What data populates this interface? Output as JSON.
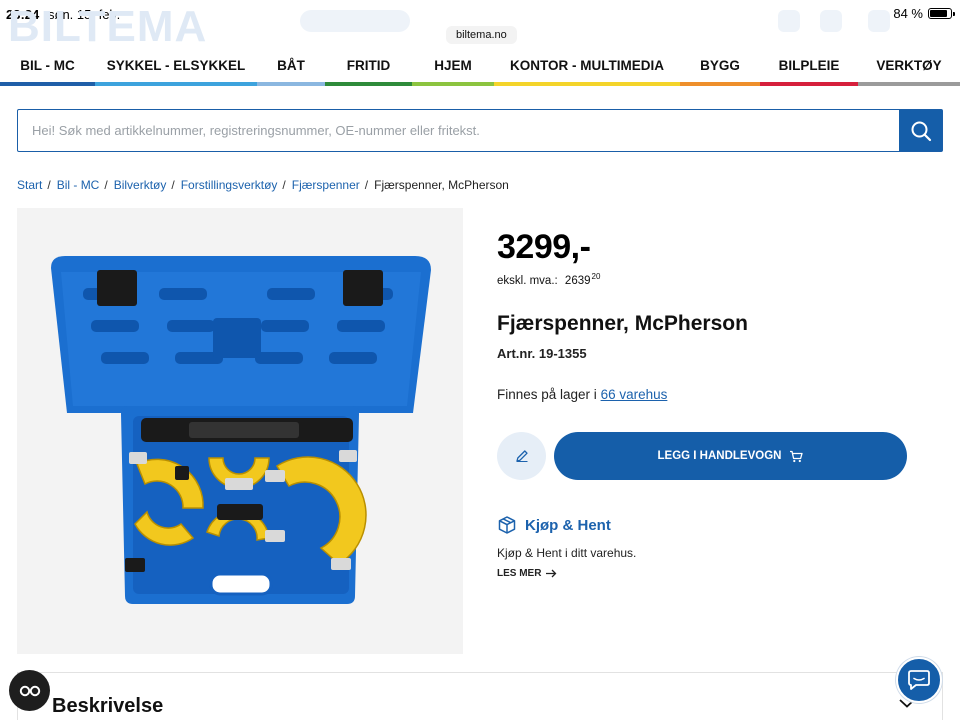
{
  "status_bar": {
    "time": "23:24",
    "date": "søn. 15. feb.",
    "battery": "84 %",
    "battery_level": 0.84
  },
  "browser": {
    "url": "biltema.no"
  },
  "header": {
    "logo": "BILTEMA"
  },
  "categories": [
    {
      "label": "BIL - MC",
      "color": "#1f5fa8"
    },
    {
      "label": "SYKKEL - ELSYKKEL",
      "color": "#3da3dd"
    },
    {
      "label": "BÅT",
      "color": "#8bb7e0"
    },
    {
      "label": "FRITID",
      "color": "#2e8b3a"
    },
    {
      "label": "HJEM",
      "color": "#8cc43f"
    },
    {
      "label": "KONTOR - MULTIMEDIA",
      "color": "#f4d42a"
    },
    {
      "label": "BYGG",
      "color": "#ee8f2b"
    },
    {
      "label": "BILPLEIE",
      "color": "#d61f3c"
    },
    {
      "label": "VERKTØY",
      "color": "#9b9b9b"
    }
  ],
  "search": {
    "placeholder": "Hei! Søk med artikkelnummer, registreringsnummer, OE-nummer eller fritekst.",
    "value": ""
  },
  "breadcrumb": {
    "items": [
      "Start",
      "Bil - MC",
      "Bilverktøy",
      "Forstillingsverktøy",
      "Fjærspenner"
    ],
    "current": "Fjærspenner, McPherson"
  },
  "product": {
    "price": "3299,-",
    "ex_vat_label": "ekskl. mva.:",
    "ex_vat_value": "2639",
    "ex_vat_decimals": "20",
    "title": "Fjærspenner, McPherson",
    "article_number": "Art.nr. 19-1355",
    "stock_prefix": "Finnes på lager i",
    "stock_link": "66 varehus",
    "add_to_cart": "LEGG I HANDLEVOGN"
  },
  "click_collect": {
    "title": "Kjøp & Hent",
    "description": "Kjøp & Hent i ditt varehus.",
    "read_more": "LES MER"
  },
  "description_section": {
    "title": "Beskrivelse"
  },
  "cookie_button": {
    "label": "CO"
  },
  "colors": {
    "brand_blue": "#155ea9",
    "link_blue": "#1c62ad",
    "case_blue": "#1b6fd0",
    "part_yellow": "#f2c81e"
  }
}
